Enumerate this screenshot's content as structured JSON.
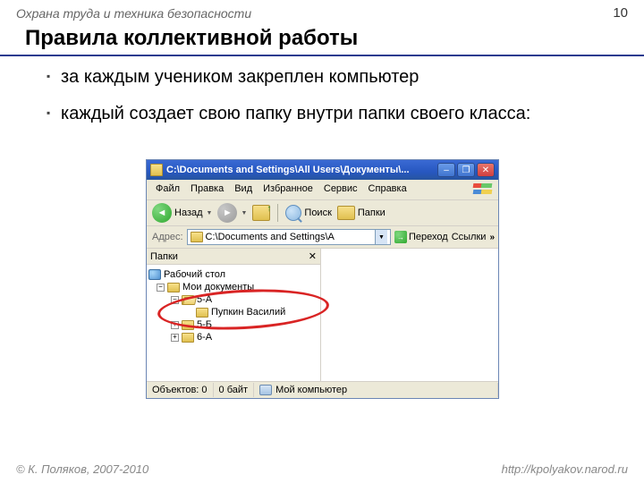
{
  "header": {
    "topic": "Охрана труда и техника безопасности",
    "page_number": "10"
  },
  "slide": {
    "title": "Правила коллективной работы",
    "bullets": [
      "за каждым учеником закреплен компьютер",
      "каждый создает свою папку внутри папки своего класса:"
    ]
  },
  "explorer": {
    "title": "C:\\Documents and Settings\\All Users\\Документы\\...",
    "menu": [
      "Файл",
      "Правка",
      "Вид",
      "Избранное",
      "Сервис",
      "Справка"
    ],
    "toolbar": {
      "back": "Назад",
      "search": "Поиск",
      "folders": "Папки"
    },
    "addressbar": {
      "label": "Адрес:",
      "path": "C:\\Documents and Settings\\A",
      "go": "Переход",
      "links": "Ссылки"
    },
    "tree": {
      "header": "Папки",
      "desktop": "Рабочий стол",
      "mydocs": "Мои документы",
      "folder_5a": "5-А",
      "folder_pupkin": "Пупкин Василий",
      "folder_5b": "5-Б",
      "folder_6a": "6-А"
    },
    "statusbar": {
      "objects": "Объектов: 0",
      "bytes": "0 байт",
      "location": "Мой компьютер"
    }
  },
  "footer": {
    "copyright": "© К. Поляков, 2007-2010",
    "url": "http://kpolyakov.narod.ru"
  }
}
